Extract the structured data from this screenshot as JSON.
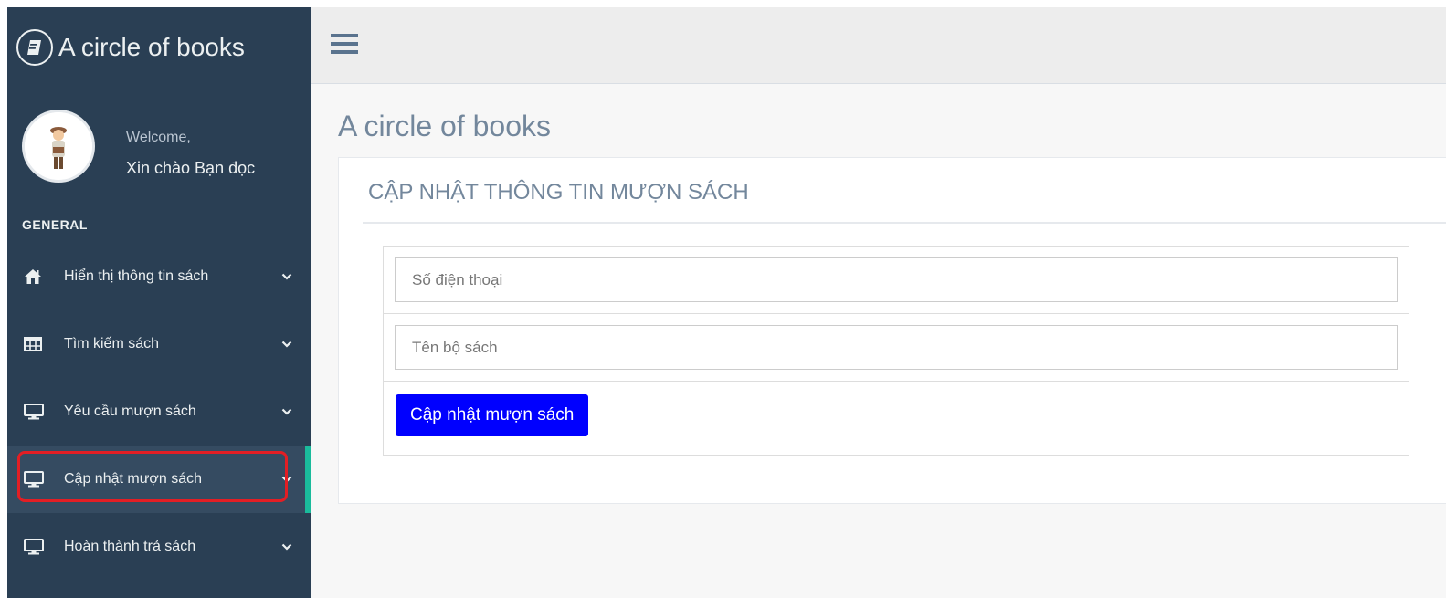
{
  "app": {
    "brand_title": "A circle of books",
    "brand_icon": "book-icon"
  },
  "profile": {
    "welcome": "Welcome,",
    "username": "Xin chào Bạn đọc"
  },
  "sidebar": {
    "section_label": "GENERAL",
    "items": [
      {
        "label": "Hiển thị thông tin sách",
        "icon": "home-icon",
        "active": false
      },
      {
        "label": "Tìm kiếm sách",
        "icon": "table-icon",
        "active": false
      },
      {
        "label": "Yêu cầu mượn sách",
        "icon": "desktop-icon",
        "active": false
      },
      {
        "label": "Cập nhật mượn sách",
        "icon": "desktop-icon",
        "active": true
      },
      {
        "label": "Hoàn thành trả sách",
        "icon": "desktop-icon",
        "active": false
      }
    ]
  },
  "topnav": {
    "menu_icon": "hamburger-icon"
  },
  "main": {
    "page_title": "A circle of books",
    "panel_title": "CẬP NHẬT THÔNG TIN MƯỢN SÁCH",
    "form": {
      "phone": {
        "placeholder": "Số điện thoại",
        "value": ""
      },
      "book_set": {
        "placeholder": "Tên bộ sách",
        "value": ""
      },
      "submit_label": "Cập nhật mượn sách"
    }
  },
  "colors": {
    "sidebar_bg": "#2a3f54",
    "accent": "#1ABB9C",
    "highlight_border": "#e31e24",
    "button_bg": "#0000ff",
    "heading_text": "#73879C"
  }
}
